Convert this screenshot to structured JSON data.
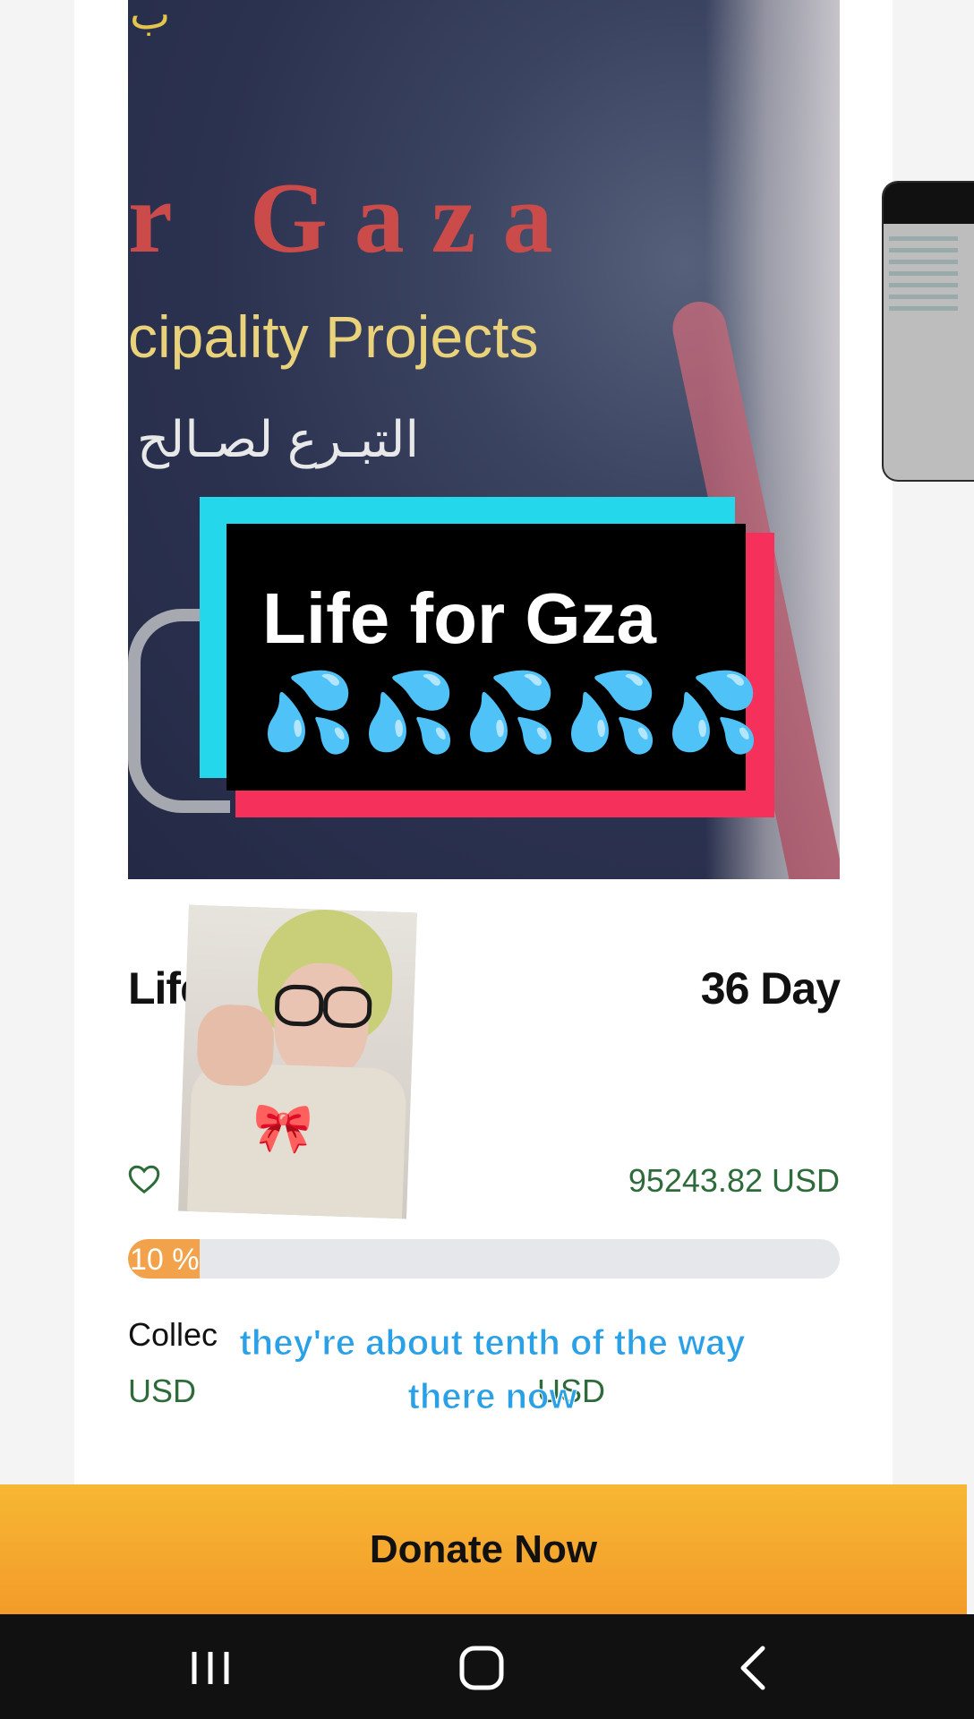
{
  "hero": {
    "arabic_top": "ب",
    "gaza_text": "r  Gaza",
    "projects_text": "cipality Projects",
    "arabic_text": "التبـرع لصـالح"
  },
  "sticker": {
    "title": "Life for Gza",
    "drops": "💦💦💦💦💦"
  },
  "campaign": {
    "title": "Life For",
    "days_left": "36 Day",
    "raised": "95243.82 USD",
    "progress_percent": 10,
    "progress_label": "10 %",
    "collected_label": "Collec",
    "usd_left": "USD",
    "usd_right": "USD"
  },
  "caption": {
    "line1": "they're about tenth of the way",
    "line2": "there now"
  },
  "donate_label": "Donate Now",
  "colors": {
    "donate": "#f7b733",
    "progress_fill": "#f2a24a",
    "money_green": "#2e6b3a",
    "caption_blue": "#2aa0e6",
    "sticker_cyan": "#25d7ea",
    "sticker_red": "#f5305b"
  },
  "nav": {
    "recent": "recents-icon",
    "home": "home-icon",
    "back": "back-icon"
  }
}
